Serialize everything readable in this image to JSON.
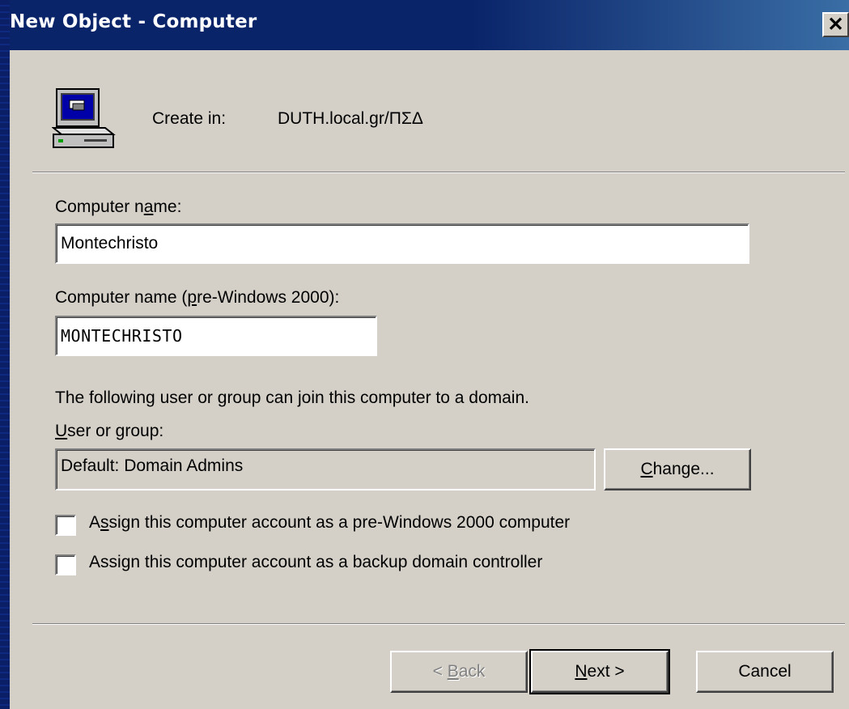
{
  "window": {
    "title": "New Object - Computer",
    "close_glyph": "✕"
  },
  "header": {
    "icon": "computer-icon",
    "create_in_label": "Create in:",
    "create_in_value": "DUTH.local.gr/ΠΣΔ"
  },
  "form": {
    "computer_name_label": "Computer name:",
    "computer_name_value": "Montechristo",
    "pre2000_label": "Computer name (pre-Windows 2000):",
    "pre2000_value": "MONTECHRISTO",
    "join_info": "The following user or group can join this computer to a domain.",
    "user_group_label": "User or group:",
    "user_group_value": "Default: Domain Admins",
    "change_button": "Change...",
    "checkbox_pre2000": {
      "label": "Assign this computer account as a pre-Windows 2000 computer",
      "checked": false
    },
    "checkbox_bdc": {
      "label": "Assign this computer account as a backup domain controller",
      "checked": false
    }
  },
  "footer": {
    "back_button": "< Back",
    "next_button": "Next >",
    "cancel_button": "Cancel"
  },
  "colors": {
    "dialog_bg": "#d4d0c8",
    "titlebar": "#0a246a",
    "title_text": "#ffffff"
  }
}
